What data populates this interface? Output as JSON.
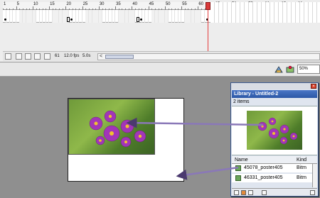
{
  "timeline": {
    "ruler_labels": [
      "1",
      "5",
      "10",
      "15",
      "20",
      "25",
      "30",
      "35",
      "40",
      "45",
      "50",
      "55",
      "60",
      "65",
      "70",
      "75",
      "80",
      "85",
      "90"
    ],
    "current_frame": "61",
    "frame_rate": "12.0 fps",
    "elapsed_time": "5.0s",
    "scroll_left_arrow": "<"
  },
  "editbar": {
    "zoom_value": "50%"
  },
  "library": {
    "title": "Library - Untitled-2",
    "close_glyph": "×",
    "item_count": "2 items",
    "col_name": "Name",
    "col_kind": "Kind",
    "items": [
      {
        "name": "45078_poster405",
        "kind": "Bitm"
      },
      {
        "name": "46331_poster405",
        "kind": "Bitm"
      }
    ]
  },
  "colors": {
    "playhead": "#e43a3a",
    "library_title": "#2b57a5",
    "arrow": "#7a5fa8"
  },
  "icons": [
    "lock-icon",
    "add-layer-icon",
    "onion-skin-icon",
    "edit-symbol-icon",
    "edit-scene-icon",
    "delete-icon",
    "new-folder-icon",
    "properties-icon"
  ]
}
